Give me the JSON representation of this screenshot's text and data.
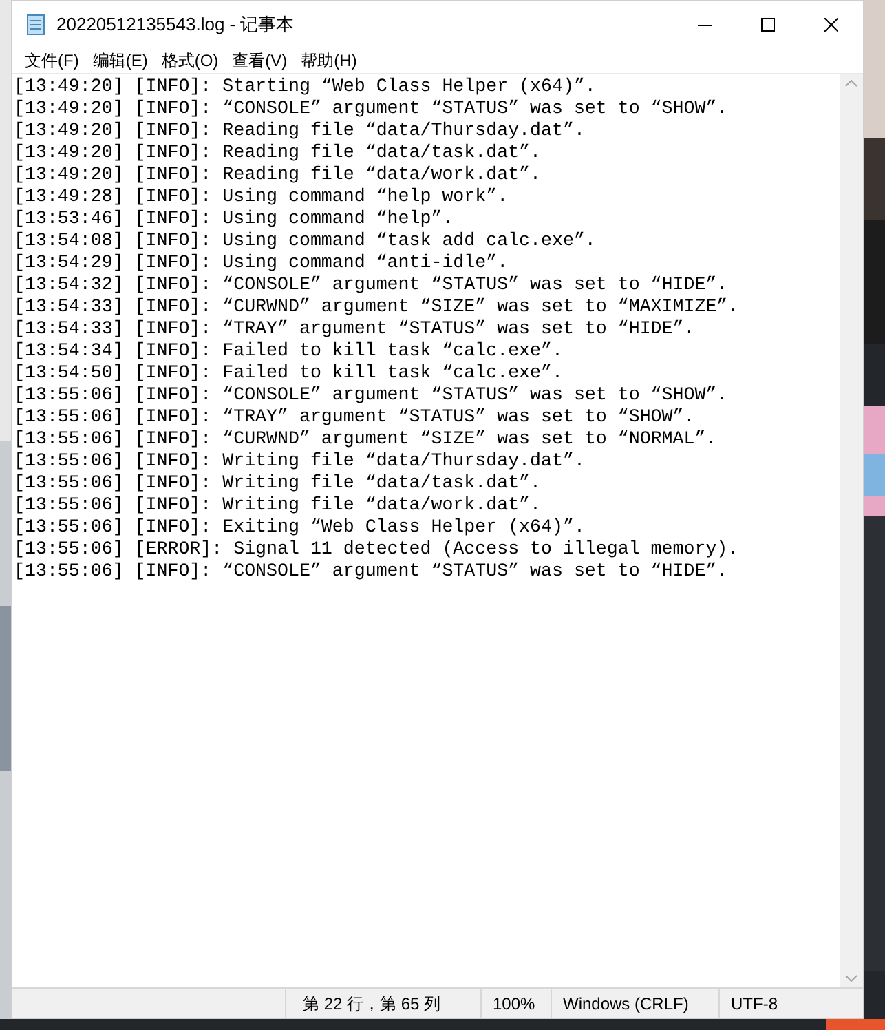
{
  "window": {
    "title": "20220512135543.log - 记事本"
  },
  "menu": [
    "文件(F)",
    "编辑(E)",
    "格式(O)",
    "查看(V)",
    "帮助(H)"
  ],
  "lines": [
    "[13:49:20] [INFO]: Starting “Web Class Helper (x64)”.",
    "[13:49:20] [INFO]: “CONSOLE” argument “STATUS” was set to “SHOW”.",
    "[13:49:20] [INFO]: Reading file “data/Thursday.dat”.",
    "[13:49:20] [INFO]: Reading file “data/task.dat”.",
    "[13:49:20] [INFO]: Reading file “data/work.dat”.",
    "[13:49:28] [INFO]: Using command “help work”.",
    "[13:53:46] [INFO]: Using command “help”.",
    "[13:54:08] [INFO]: Using command “task add calc.exe”.",
    "[13:54:29] [INFO]: Using command “anti-idle”.",
    "[13:54:32] [INFO]: “CONSOLE” argument “STATUS” was set to “HIDE”.",
    "[13:54:33] [INFO]: “CURWND” argument “SIZE” was set to “MAXIMIZE”.",
    "[13:54:33] [INFO]: “TRAY” argument “STATUS” was set to “HIDE”.",
    "[13:54:34] [INFO]: Failed to kill task “calc.exe”.",
    "[13:54:50] [INFO]: Failed to kill task “calc.exe”.",
    "[13:55:06] [INFO]: “CONSOLE” argument “STATUS” was set to “SHOW”.",
    "[13:55:06] [INFO]: “TRAY” argument “STATUS” was set to “SHOW”.",
    "[13:55:06] [INFO]: “CURWND” argument “SIZE” was set to “NORMAL”.",
    "[13:55:06] [INFO]: Writing file “data/Thursday.dat”.",
    "[13:55:06] [INFO]: Writing file “data/task.dat”.",
    "[13:55:06] [INFO]: Writing file “data/work.dat”.",
    "[13:55:06] [INFO]: Exiting “Web Class Helper (x64)”.",
    "[13:55:06] [ERROR]: Signal 11 detected (Access to illegal memory).",
    "[13:55:06] [INFO]: “CONSOLE” argument “STATUS” was set to “HIDE”."
  ],
  "status_bar": {
    "position": "第 22 行，第 65 列",
    "zoom": "100%",
    "line_ending": "Windows (CRLF)",
    "encoding": "UTF-8"
  }
}
